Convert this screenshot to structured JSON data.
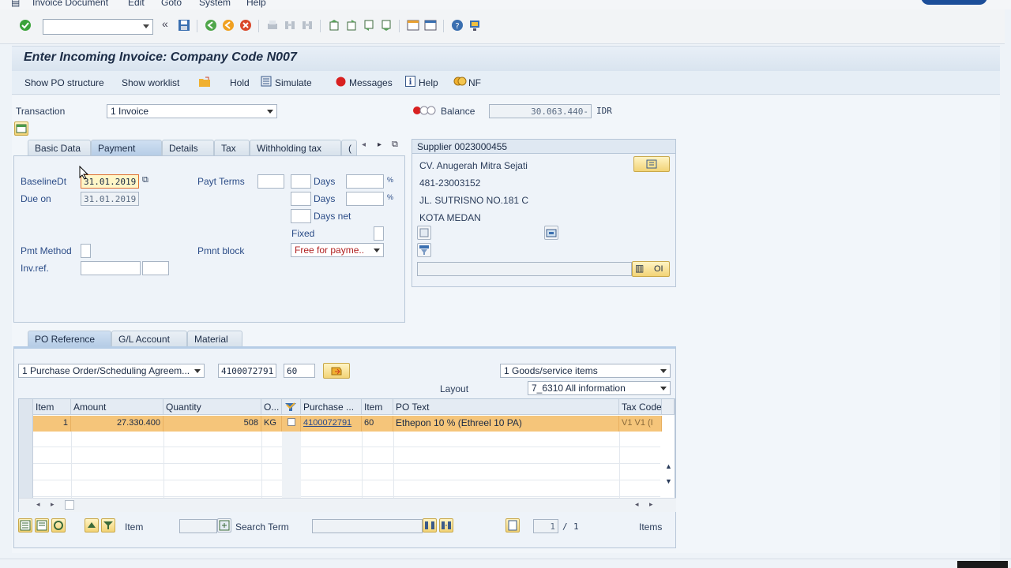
{
  "menu": [
    "Invoice Document",
    "Edit",
    "Goto",
    "System",
    "Help"
  ],
  "title": "Enter Incoming Invoice: Company Code N007",
  "app_toolbar": {
    "show_po_structure": "Show PO structure",
    "show_worklist": "Show worklist",
    "hold": "Hold",
    "simulate": "Simulate",
    "messages": "Messages",
    "help": "Help",
    "nf": "NF"
  },
  "transaction": {
    "label": "Transaction",
    "value": "1 Invoice"
  },
  "balance": {
    "label": "Balance",
    "value": "30.063.440-",
    "currency": "IDR"
  },
  "header_tabs": [
    "Basic Data",
    "Payment",
    "Details",
    "Tax",
    "Withholding tax",
    "("
  ],
  "payment": {
    "baseline_label": "BaselineDt",
    "baseline_value": "31.01.2019",
    "due_label": "Due on",
    "due_value": "31.01.2019",
    "payt_terms_label": "Payt Terms",
    "days1": "Days",
    "days2": "Days",
    "days_net": "Days net",
    "percent1": "%",
    "percent2": "%",
    "fixed": "Fixed",
    "pmt_method_label": "Pmt Method",
    "pmnt_block_label": "Pmnt block",
    "pmnt_block_value": "Free for payme..",
    "inv_ref_label": "Inv.ref."
  },
  "supplier": {
    "header": "Supplier 0023000455",
    "name": "CV. Anugerah Mitra Sejati",
    "phone": "481-23003152",
    "street": "JL. SUTRISNO NO.181 C",
    "city": "KOTA MEDAN",
    "oi": "OI"
  },
  "item_tabs": [
    "PO Reference",
    "G/L Account",
    "Material"
  ],
  "po_ref": {
    "type_value": "1 Purchase Order/Scheduling Agreem...",
    "po_number": "4100072791",
    "item": "60",
    "goods_value": "1 Goods/service items",
    "layout_label": "Layout",
    "layout_value": "7_6310 All information"
  },
  "grid": {
    "headers": [
      "Item",
      "Amount",
      "Quantity",
      "O...",
      "",
      "Purchase ...",
      "Item",
      "PO Text",
      "Tax Code"
    ],
    "rows": [
      [
        "1",
        "27.330.400",
        "508",
        "KG",
        "",
        "4100072791",
        "60",
        "Ethepon 10 % (Ethreel 10 PA)",
        "V1  V1  (I"
      ]
    ]
  },
  "bottom": {
    "item_label": "Item",
    "search_label": "Search Term",
    "page_current": "1",
    "page_sep": "/",
    "page_total": "1",
    "items_label": "Items"
  }
}
